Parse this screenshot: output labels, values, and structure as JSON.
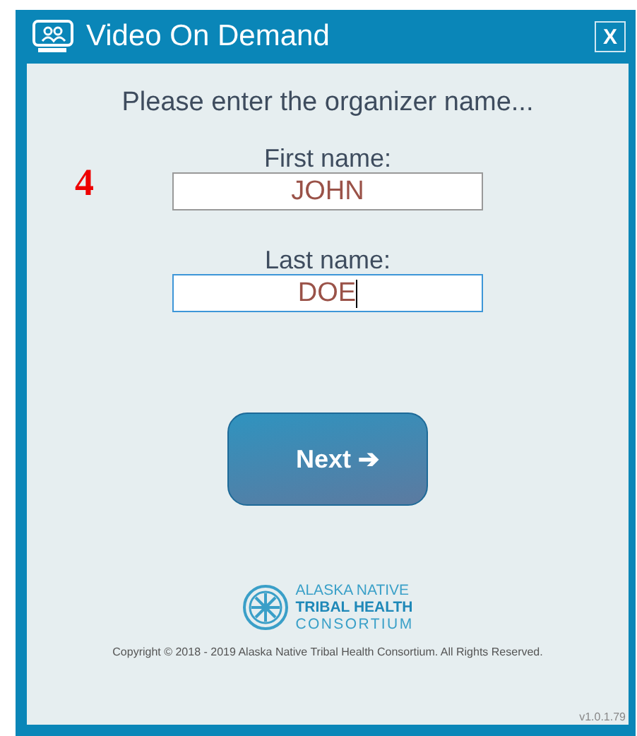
{
  "window": {
    "title": "Video On Demand",
    "close": "X"
  },
  "prompt": "Please enter the organizer name...",
  "step_marker": "4",
  "fields": [
    {
      "label": "First name:",
      "value": "JOHN",
      "focused": false
    },
    {
      "label": "Last name:",
      "value": "DOE",
      "focused": true
    }
  ],
  "next_button": {
    "label": "Next",
    "arrow": "➔"
  },
  "logo": {
    "lines": [
      "ALASKA NATIVE",
      "TRIBAL HEALTH",
      "CONSORTIUM"
    ]
  },
  "copyright": "Copyright © 2018 - 2019 Alaska Native Tribal Health Consortium. All Rights Reserved.",
  "version": "v1.0.1.79"
}
